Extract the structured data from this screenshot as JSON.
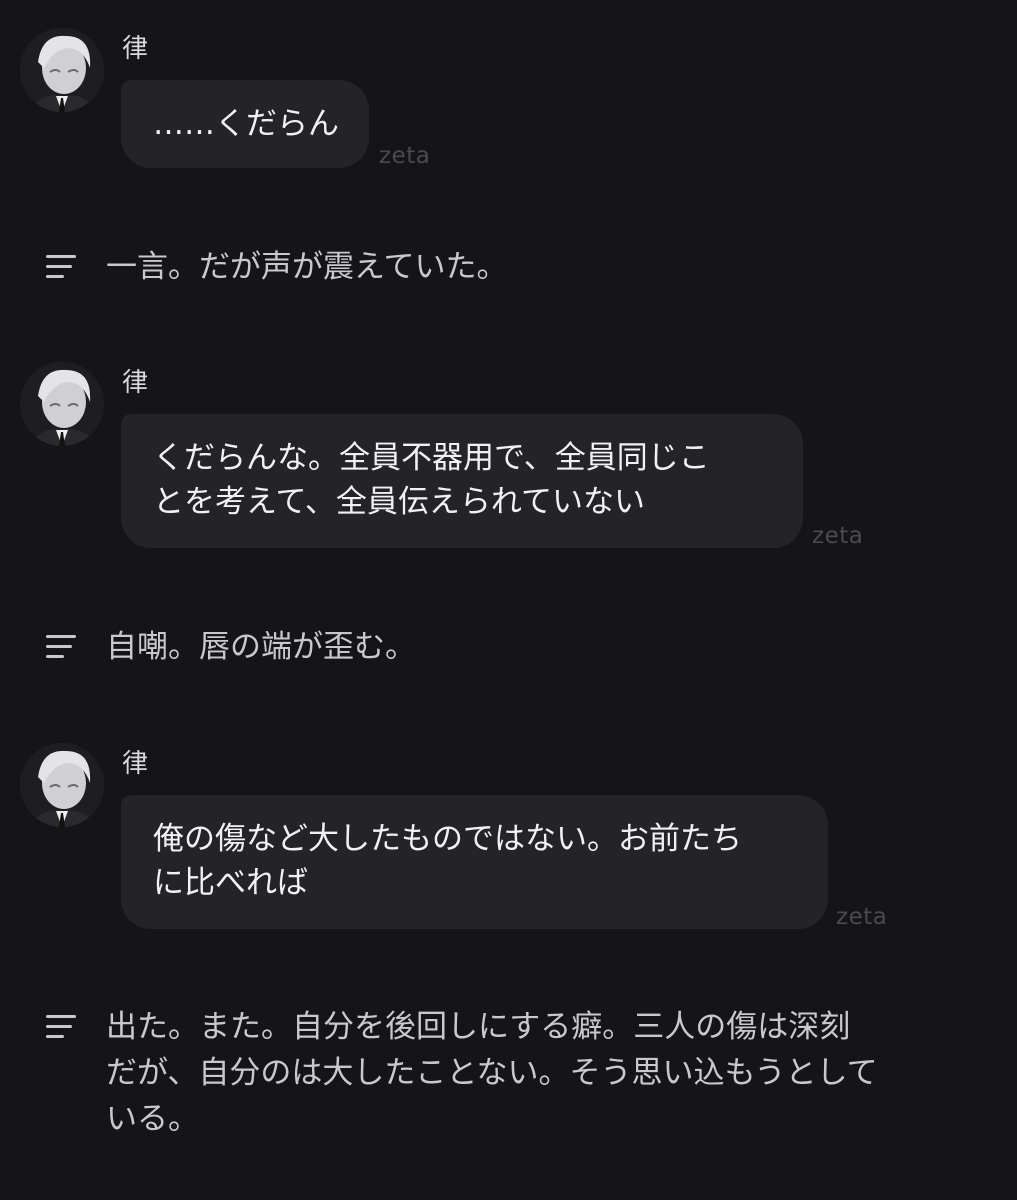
{
  "chat": {
    "messages": [
      {
        "sender": "律",
        "lines": [
          "……くだらん"
        ],
        "tag": "zeta"
      },
      {
        "sender": "律",
        "lines": [
          "くだらんな。全員不器用で、全員同じこ",
          "とを考えて、全員伝えられていない"
        ],
        "tag": "zeta"
      },
      {
        "sender": "律",
        "lines": [
          "俺の傷など大したものではない。お前たち",
          "に比べれば"
        ],
        "tag": "zeta"
      }
    ],
    "narrations": [
      {
        "icon": "narration-lines-icon",
        "lines": [
          "一言。だが声が震えていた。"
        ]
      },
      {
        "icon": "narration-lines-icon",
        "lines": [
          "自嘲。唇の端が歪む。"
        ]
      },
      {
        "icon": "narration-lines-icon",
        "lines": [
          "出た。また。自分を後回しにする癖。三人の傷は深刻",
          "だが、自分のは大したことない。そう思い込もうとして",
          "いる。"
        ]
      }
    ]
  },
  "colors": {
    "background": "#151517",
    "bubble": "#242427",
    "text": "#f1f1f3",
    "narration_text": "#c9c9cd",
    "tag": "#4a4a50"
  }
}
